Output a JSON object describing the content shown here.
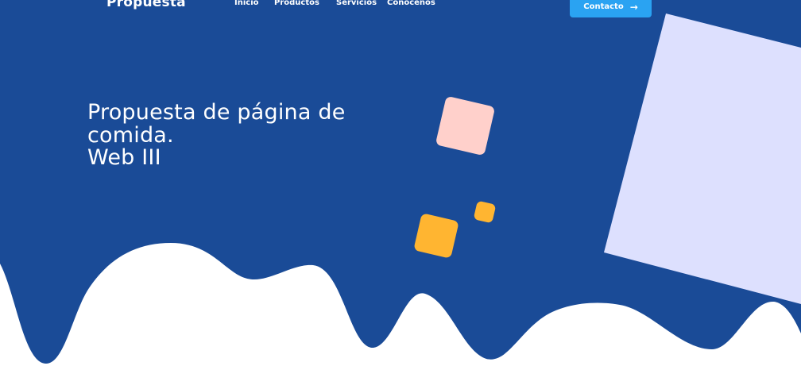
{
  "header": {
    "brand": "Propuesta",
    "nav": [
      {
        "label": "Inicio"
      },
      {
        "label": "Productos"
      },
      {
        "label": "Servicios"
      },
      {
        "label": "Conocenos"
      }
    ],
    "contact_button": {
      "label": "Contacto",
      "icon": "arrow-right-icon",
      "arrow_glyph": "→"
    }
  },
  "hero": {
    "title_lines": [
      "Propuesta de página de",
      "comida.",
      "Web III"
    ]
  },
  "colors": {
    "background_blue": "#1a4b97",
    "button_blue": "#2aa3f2",
    "lavender": "#dde0fe",
    "pink": "#ffd0cb",
    "orange": "#ffb531",
    "white": "#ffffff"
  }
}
